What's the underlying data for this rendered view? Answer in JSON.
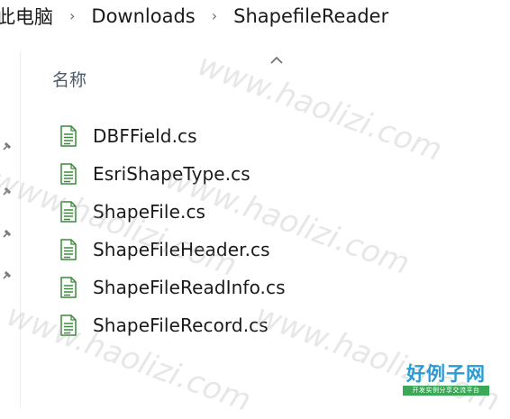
{
  "breadcrumb": {
    "items": [
      "此电脑",
      "Downloads",
      "ShapefileReader"
    ]
  },
  "column_header": {
    "name_label": "名称",
    "sort_icon": "chevron-up-icon"
  },
  "files": [
    {
      "name": "DBFField.cs",
      "icon": "text-file-icon"
    },
    {
      "name": "EsriShapeType.cs",
      "icon": "text-file-icon"
    },
    {
      "name": "ShapeFile.cs",
      "icon": "text-file-icon"
    },
    {
      "name": "ShapeFileHeader.cs",
      "icon": "text-file-icon"
    },
    {
      "name": "ShapeFileReadInfo.cs",
      "icon": "text-file-icon"
    },
    {
      "name": "ShapeFileRecord.cs",
      "icon": "text-file-icon"
    }
  ],
  "nav_pins": [
    "pin-icon",
    "pin-icon",
    "pin-icon",
    "pin-icon"
  ],
  "watermark": {
    "text": "www.haolizi.com",
    "logo_title": "好例子网",
    "logo_subtitle": "开发实例分享交流平台"
  },
  "colors": {
    "header_text": "#4d5a6e",
    "icon_green": "#3c8a3c",
    "logo_blue": "#2a9bd5",
    "logo_green": "#3aa856"
  }
}
